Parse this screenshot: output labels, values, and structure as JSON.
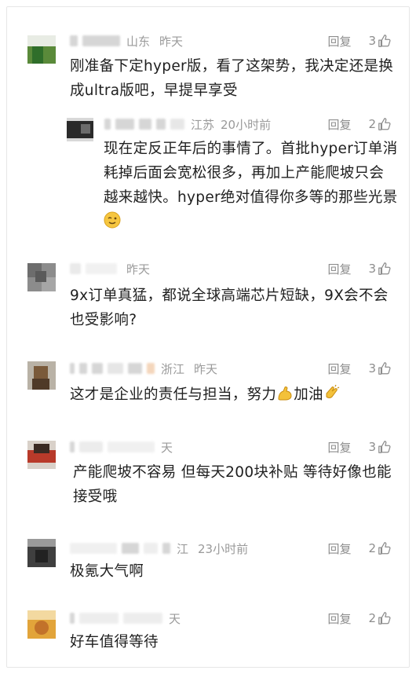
{
  "comments": [
    {
      "location": "山东",
      "time": "昨天",
      "reply_label": "回复",
      "likes": "3",
      "text": "刚准备下定hyper版，看了这架势，我决定还是换成ultra版吧，早提早享受"
    },
    {
      "location": "江苏",
      "time": "20小时前",
      "reply_label": "回复",
      "likes": "2",
      "text": "现在定反正年后的事情了。首批hyper订单消耗掉后面会宽松很多，再加上产能爬坡只会越来越快。hyper绝对值得你多等的那些光景"
    },
    {
      "location": "",
      "time": "昨天",
      "reply_label": "回复",
      "likes": "3",
      "text": "9x订单真猛，都说全球高端芯片短缺，9X会不会也受影响?"
    },
    {
      "location": "浙江",
      "time": "昨天",
      "reply_label": "回复",
      "likes": "3",
      "text_a": "这才是企业的责任与担当，努力",
      "text_b": "加油"
    },
    {
      "location": "",
      "time": "天",
      "reply_label": "回复",
      "likes": "3",
      "text": "产能爬坡不容易 但每天200块补贴 等待好像也能接受哦"
    },
    {
      "location": "江",
      "time": "23小时前",
      "reply_label": "回复",
      "likes": "2",
      "text": "极氪大气啊"
    },
    {
      "location": "",
      "time": "天",
      "reply_label": "回复",
      "likes": "2",
      "text": "好车值得等待"
    }
  ],
  "icons": {
    "like": "thumbs-up-icon",
    "emoji_wink": "wink-emoji",
    "emoji_muscle": "muscle-emoji",
    "emoji_clap": "clap-emoji"
  },
  "colors": {
    "meta_gray": "#9a9a9a",
    "text": "#1f1f1f"
  }
}
